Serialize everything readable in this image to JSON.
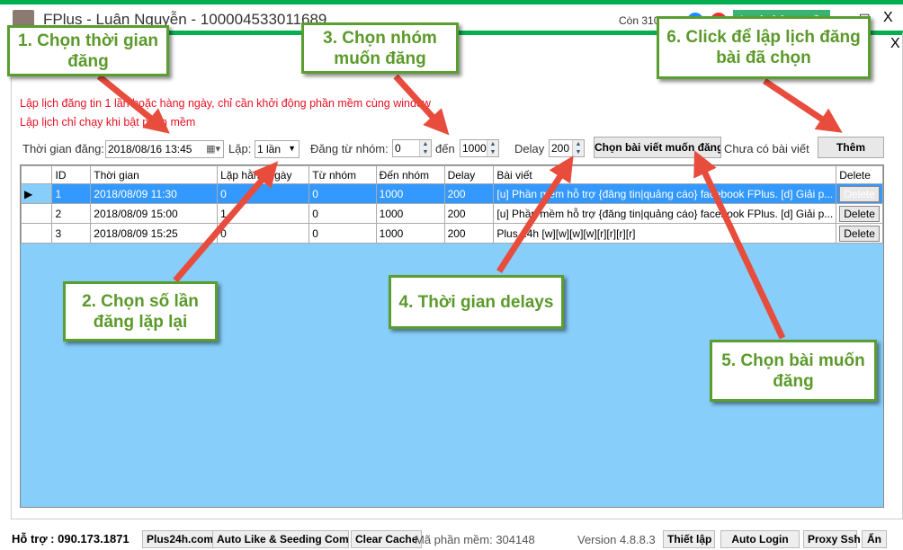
{
  "window": {
    "title": "FPlus - Luận Nguyễn - 100004533011689",
    "remaining": "Còn 310 ngày",
    "login_button": "Login bản quyền",
    "maximize": "☐",
    "close": "X"
  },
  "dialog": {
    "close": "X",
    "notes": [
      "Lập lịch đăng tin 1 lần hoặc hàng ngày, chỉ cần khởi động phần mềm cùng window",
      "Lập lịch chỉ chạy khi bật phần mềm"
    ]
  },
  "controls": {
    "time_label": "Thời gian đăng:",
    "time_value": "2018/08/16 13:45",
    "repeat_label": "Lặp:",
    "repeat_value": "1 lần",
    "from_group_label": "Đăng từ nhóm:",
    "from_group_value": "0",
    "to_label": "đến",
    "to_value": "1000",
    "delay_label": "Delay",
    "delay_value": "200",
    "choose_post_button": "Chọn bài viết muốn đăng",
    "post_status": "Chưa có bài viết",
    "add_button": "Thêm"
  },
  "grid": {
    "columns": [
      "ID",
      "Thời gian",
      "Lặp hằng ngày",
      "Từ nhóm",
      "Đến nhóm",
      "Delay",
      "Bài viết",
      "Delete"
    ],
    "rows": [
      {
        "id": "1",
        "time": "2018/08/09 11:30",
        "repeat": "0",
        "from": "0",
        "to": "1000",
        "delay": "200",
        "post": "[u] Phần mềm hỗ trợ {đăng tin|quảng cáo} facebook FPlus. [d] Giải p...",
        "delete": "Delete",
        "selected": true
      },
      {
        "id": "2",
        "time": "2018/08/09 15:00",
        "repeat": "1",
        "from": "0",
        "to": "1000",
        "delay": "200",
        "post": "[u] Phần mềm hỗ trợ {đăng tin|quảng cáo} facebook FPlus. [d] Giải p...",
        "delete": "Delete",
        "selected": false
      },
      {
        "id": "3",
        "time": "2018/08/09 15:25",
        "repeat": "0",
        "from": "0",
        "to": "1000",
        "delay": "200",
        "post": "Plus 24h  [w][w][w][w][r][r][r][r]",
        "delete": "Delete",
        "selected": false
      }
    ]
  },
  "footer": {
    "support": "Hỗ trợ : 090.173.1871",
    "buttons": [
      "Plus24h.com",
      "Auto Like & Seeding Com...",
      "Clear Cache"
    ],
    "software_code": "Mã phần mềm: 304148",
    "version": "Version 4.8.8.3",
    "right_buttons": [
      "Thiết lập",
      "Auto Login",
      "Proxy Ssh",
      "Ẩn"
    ]
  },
  "callouts": [
    "1. Chọn thời gian đăng",
    "2. Chọn số lần đăng lặp lại",
    "3. Chọn nhóm muốn đăng",
    "4. Thời gian delays",
    "5. Chọn bài muốn đăng",
    "6. Click để lập lịch đăng bài đã chọn"
  ],
  "colors": {
    "accent": "#00b050",
    "callout": "#5a9e2f",
    "arrow": "#e74c3c",
    "grid_bg": "#87cefa",
    "selected_row": "#3399ff",
    "note": "#e81123"
  }
}
